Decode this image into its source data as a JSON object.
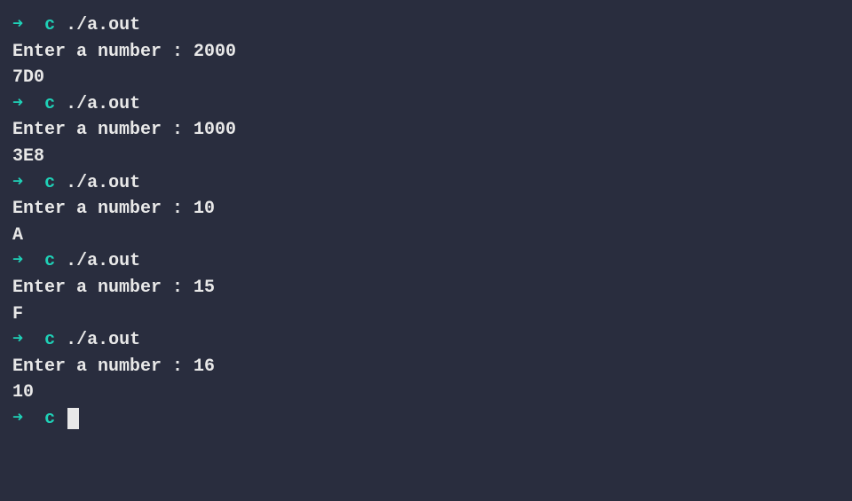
{
  "prompt": {
    "arrow": "➜",
    "dir": "c",
    "command": "./a.out"
  },
  "runs": [
    {
      "prompt_text": "Enter a number : ",
      "input": "2000",
      "output": "7D0"
    },
    {
      "prompt_text": "Enter a number : ",
      "input": "1000",
      "output": "3E8"
    },
    {
      "prompt_text": "Enter a number : ",
      "input": "10",
      "output": "A"
    },
    {
      "prompt_text": "Enter a number : ",
      "input": "15",
      "output": "F"
    },
    {
      "prompt_text": "Enter a number : ",
      "input": "16",
      "output": "10"
    }
  ]
}
